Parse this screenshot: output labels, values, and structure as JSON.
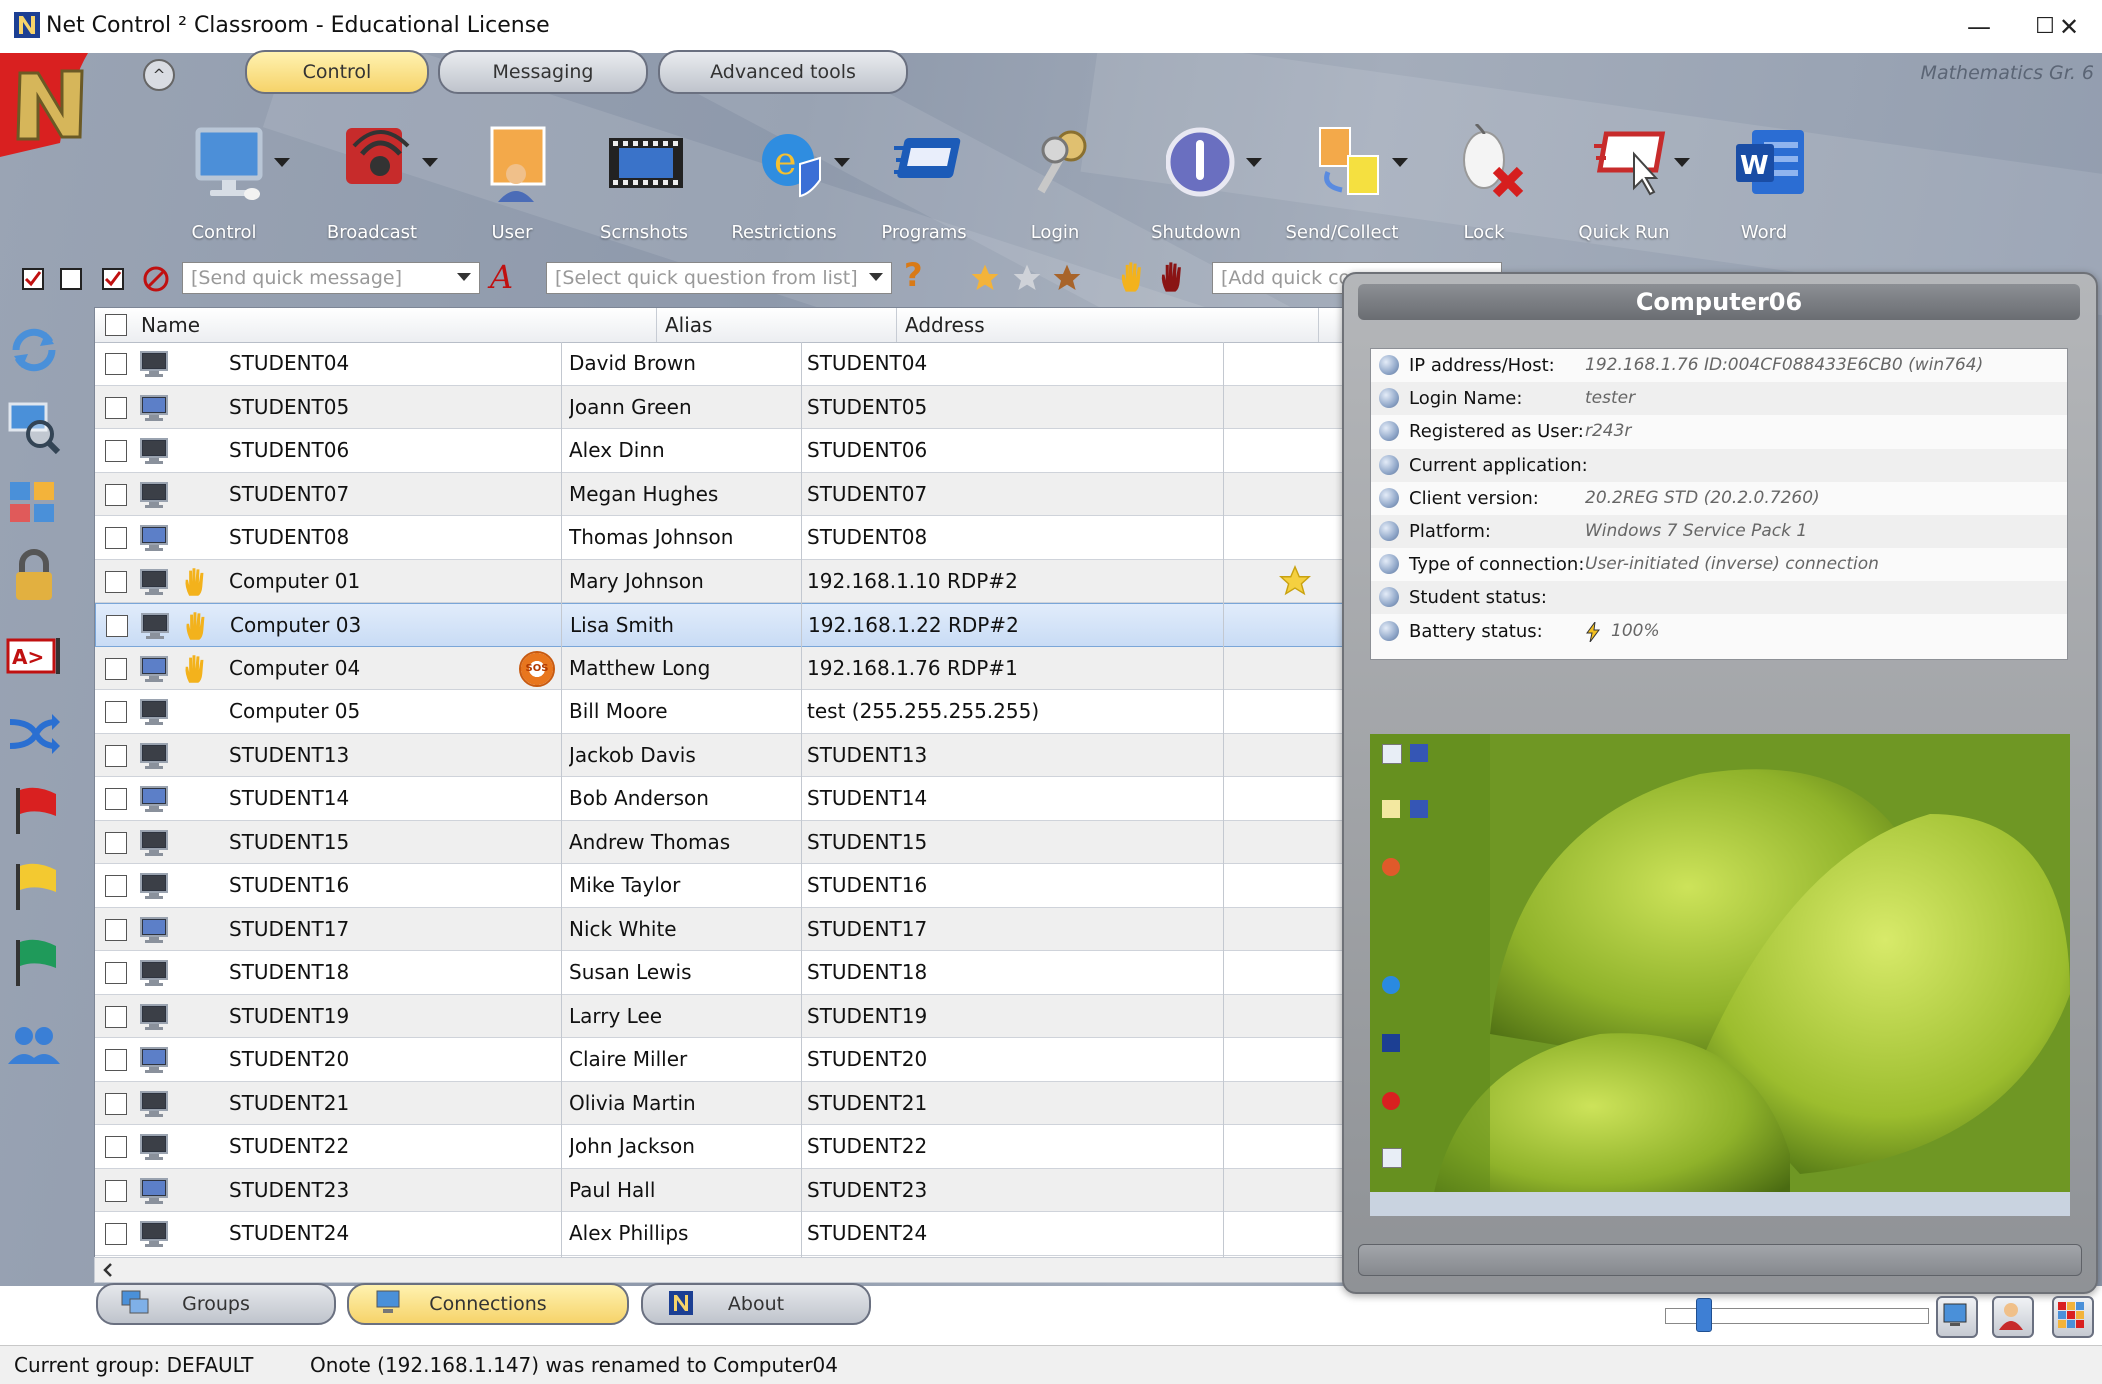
{
  "window": {
    "title": "Net Control ² Classroom - Educational License",
    "minimize": "—",
    "maximize": "☐",
    "close": "✕"
  },
  "tabs": [
    {
      "label": "Control",
      "active": true
    },
    {
      "label": "Messaging",
      "active": false
    },
    {
      "label": "Advanced tools",
      "active": false
    }
  ],
  "collapse_glyph": "^",
  "group_name": "Mathematics Gr. 6",
  "toolbar": [
    {
      "label": "Control",
      "icon": "monitor-icon",
      "dropdown": true
    },
    {
      "label": "Broadcast",
      "icon": "broadcast-icon",
      "dropdown": true
    },
    {
      "label": "User",
      "icon": "user-icon",
      "dropdown": false
    },
    {
      "label": "Scrnshots",
      "icon": "filmstrip-icon",
      "dropdown": false
    },
    {
      "label": "Restrictions",
      "icon": "ie-shield-icon",
      "dropdown": true
    },
    {
      "label": "Programs",
      "icon": "programs-icon",
      "dropdown": false
    },
    {
      "label": "Login",
      "icon": "keys-icon",
      "dropdown": false
    },
    {
      "label": "Shutdown",
      "icon": "power-icon",
      "dropdown": true
    },
    {
      "label": "Send/Collect",
      "icon": "files-icon",
      "dropdown": true
    },
    {
      "label": "Lock",
      "icon": "mouse-lock-icon",
      "dropdown": false
    },
    {
      "label": "Quick Run",
      "icon": "quick-run-icon",
      "dropdown": true
    },
    {
      "label": "Word",
      "icon": "word-icon",
      "dropdown": false
    }
  ],
  "quick": {
    "message_placeholder": "[Send quick message]",
    "question_placeholder": "[Select quick question from list]",
    "command_placeholder": "[Add quick co",
    "help_glyph": "?",
    "font_glyph": "A"
  },
  "columns": {
    "name": "Name",
    "alias": "Alias",
    "address": "Address"
  },
  "rows": [
    {
      "name": "STUDENT04",
      "alias": "David Brown",
      "address": "STUDENT04",
      "hand": false,
      "sos": false,
      "selected": false
    },
    {
      "name": "STUDENT05",
      "alias": "Joann Green",
      "address": "STUDENT05",
      "hand": false,
      "sos": false,
      "selected": false
    },
    {
      "name": "STUDENT06",
      "alias": "Alex Dinn",
      "address": "STUDENT06",
      "hand": false,
      "sos": false,
      "selected": false
    },
    {
      "name": "STUDENT07",
      "alias": "Megan Hughes",
      "address": "STUDENT07",
      "hand": false,
      "sos": false,
      "selected": false
    },
    {
      "name": "STUDENT08",
      "alias": "Thomas Johnson",
      "address": "STUDENT08",
      "hand": false,
      "sos": false,
      "selected": false
    },
    {
      "name": "Computer 01",
      "alias": "Mary Johnson",
      "address": "192.168.1.10 RDP#2",
      "hand": true,
      "sos": false,
      "selected": false
    },
    {
      "name": "Computer 03",
      "alias": "Lisa Smith",
      "address": "192.168.1.22 RDP#2",
      "hand": true,
      "sos": false,
      "selected": true
    },
    {
      "name": "Computer 04",
      "alias": "Matthew Long",
      "address": "192.168.1.76 RDP#1",
      "hand": true,
      "sos": true,
      "selected": false
    },
    {
      "name": "Computer 05",
      "alias": "Bill Moore",
      "address": "test (255.255.255.255)",
      "hand": false,
      "sos": false,
      "selected": false
    },
    {
      "name": "STUDENT13",
      "alias": "Jackob Davis",
      "address": "STUDENT13",
      "hand": false,
      "sos": false,
      "selected": false
    },
    {
      "name": "STUDENT14",
      "alias": "Bob Anderson",
      "address": "STUDENT14",
      "hand": false,
      "sos": false,
      "selected": false
    },
    {
      "name": "STUDENT15",
      "alias": "Andrew Thomas",
      "address": "STUDENT15",
      "hand": false,
      "sos": false,
      "selected": false
    },
    {
      "name": "STUDENT16",
      "alias": "Mike Taylor",
      "address": "STUDENT16",
      "hand": false,
      "sos": false,
      "selected": false
    },
    {
      "name": "STUDENT17",
      "alias": "Nick White",
      "address": "STUDENT17",
      "hand": false,
      "sos": false,
      "selected": false
    },
    {
      "name": "STUDENT18",
      "alias": "Susan Lewis",
      "address": "STUDENT18",
      "hand": false,
      "sos": false,
      "selected": false
    },
    {
      "name": "STUDENT19",
      "alias": "Larry Lee",
      "address": "STUDENT19",
      "hand": false,
      "sos": false,
      "selected": false
    },
    {
      "name": "STUDENT20",
      "alias": "Claire Miller",
      "address": "STUDENT20",
      "hand": false,
      "sos": false,
      "selected": false
    },
    {
      "name": "STUDENT21",
      "alias": "Olivia Martin",
      "address": "STUDENT21",
      "hand": false,
      "sos": false,
      "selected": false
    },
    {
      "name": "STUDENT22",
      "alias": "John Jackson",
      "address": "STUDENT22",
      "hand": false,
      "sos": false,
      "selected": false
    },
    {
      "name": "STUDENT23",
      "alias": "Paul Hall",
      "address": "STUDENT23",
      "hand": false,
      "sos": false,
      "selected": false
    },
    {
      "name": "STUDENT24",
      "alias": "Alex Phillips",
      "address": "STUDENT24",
      "hand": false,
      "sos": false,
      "selected": false
    }
  ],
  "sos_label": "SOS",
  "panel": {
    "title": "Computer06",
    "fields": [
      {
        "label": "IP address/Host:",
        "value": "192.168.1.76 ID:004CF088433E6CB0 (win764)"
      },
      {
        "label": "Login Name:",
        "value": "tester"
      },
      {
        "label": "Registered as User:",
        "value": "r243r"
      },
      {
        "label": "Current application:",
        "value": ""
      },
      {
        "label": "Client version:",
        "value": "20.2REG STD  (20.2.0.7260)"
      },
      {
        "label": "Platform:",
        "value": "Windows 7 Service Pack 1"
      },
      {
        "label": "Type of connection:",
        "value": "User-initiated (inverse) connection"
      },
      {
        "label": "Student status:",
        "value": ""
      },
      {
        "label": "Battery status:",
        "value": "100%"
      }
    ]
  },
  "bottom_tabs": [
    {
      "label": "Groups",
      "active": false
    },
    {
      "label": "Connections",
      "active": true
    },
    {
      "label": "About",
      "active": false
    }
  ],
  "status": {
    "group": "Current group: DEFAULT",
    "message": "Onote (192.168.1.147) was renamed to Computer04"
  },
  "colors": {
    "accent_tab": "#f6d36a",
    "selection": "#c9dcf5",
    "panel": "#9a9da1"
  }
}
